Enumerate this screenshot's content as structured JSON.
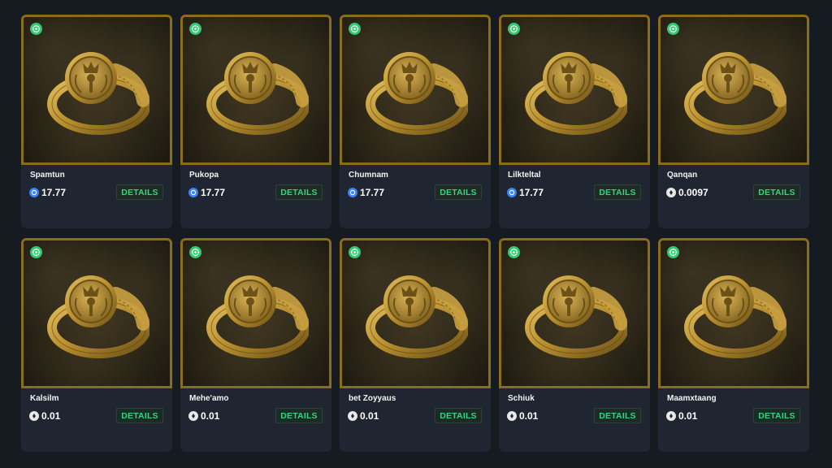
{
  "colors": {
    "background": "#161b22",
    "card": "#1f2631",
    "frame_gold": "#8a6d18",
    "accent_green": "#32d77a",
    "badge_green": "#2ecc71",
    "coin_blue": "#3b82f6"
  },
  "badge_icon": "verified-badge-icon",
  "items": [
    {
      "name": "Spamtun",
      "price": "17.77",
      "currency_icon": "blue-coin-icon",
      "details_label": "DETAILS"
    },
    {
      "name": "Pukopa",
      "price": "17.77",
      "currency_icon": "blue-coin-icon",
      "details_label": "DETAILS"
    },
    {
      "name": "Chumnam",
      "price": "17.77",
      "currency_icon": "blue-coin-icon",
      "details_label": "DETAILS"
    },
    {
      "name": "Lilkteltal",
      "price": "17.77",
      "currency_icon": "blue-coin-icon",
      "details_label": "DETAILS"
    },
    {
      "name": "Qanqan",
      "price": "0.0097",
      "currency_icon": "white-coin-icon",
      "details_label": "DETAILS"
    },
    {
      "name": "Kalsilm",
      "price": "0.01",
      "currency_icon": "white-coin-icon",
      "details_label": "DETAILS"
    },
    {
      "name": "Mehe'amo",
      "price": "0.01",
      "currency_icon": "white-coin-icon",
      "details_label": "DETAILS"
    },
    {
      "name": "bet Zoyyaus",
      "price": "0.01",
      "currency_icon": "white-coin-icon",
      "details_label": "DETAILS"
    },
    {
      "name": "Schiuk",
      "price": "0.01",
      "currency_icon": "white-coin-icon",
      "details_label": "DETAILS"
    },
    {
      "name": "Maamxtaang",
      "price": "0.01",
      "currency_icon": "white-coin-icon",
      "details_label": "DETAILS"
    }
  ]
}
